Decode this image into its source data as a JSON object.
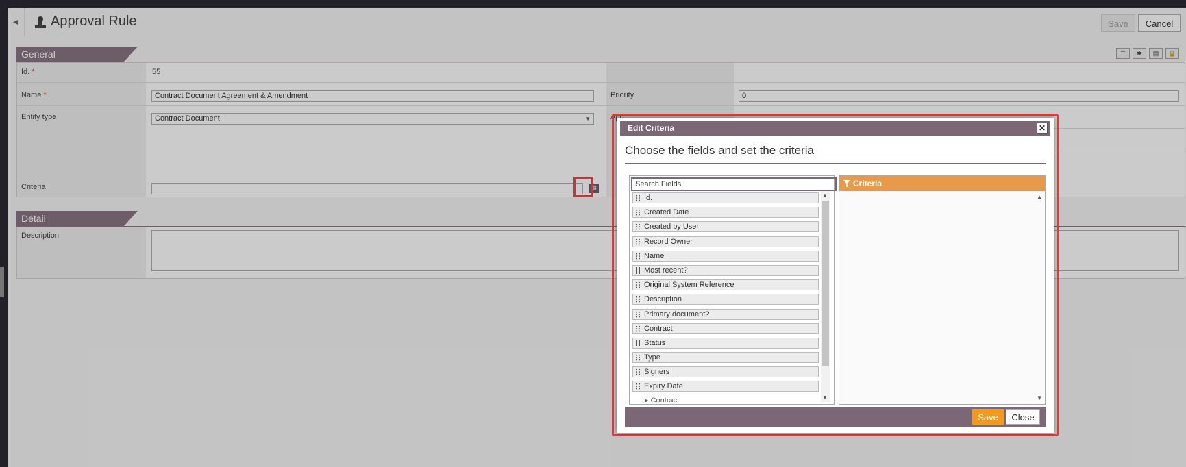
{
  "header": {
    "title": "Approval Rule",
    "save_label": "Save",
    "cancel_label": "Cancel"
  },
  "general": {
    "section_title": "General",
    "id_label": "Id.",
    "id_value": "55",
    "name_label": "Name",
    "name_value": "Contract Document Agreement & Amendment",
    "priority_label": "Priority",
    "priority_value": "0",
    "entity_type_label": "Entity type",
    "entity_type_value": "Contract Document",
    "approval_label": "App",
    "criteria_label": "Criteria",
    "required_mark": "*"
  },
  "detail": {
    "section_title": "Detail",
    "description_label": "Description"
  },
  "dialog": {
    "title": "Edit Criteria",
    "heading": "Choose the fields and set the criteria",
    "search_placeholder": "Search Fields",
    "criteria_title": "Criteria",
    "fields": [
      {
        "label": "Id.",
        "grip": "dots"
      },
      {
        "label": "Created Date",
        "grip": "dots"
      },
      {
        "label": "Created by User",
        "grip": "dots"
      },
      {
        "label": "Record Owner",
        "grip": "dots"
      },
      {
        "label": "Name",
        "grip": "dots"
      },
      {
        "label": "Most recent?",
        "grip": "bars"
      },
      {
        "label": "Original System Reference",
        "grip": "dots"
      },
      {
        "label": "Description",
        "grip": "dots"
      },
      {
        "label": "Primary document?",
        "grip": "dots"
      },
      {
        "label": "Contract",
        "grip": "dots"
      },
      {
        "label": "Status",
        "grip": "bars"
      },
      {
        "label": "Type",
        "grip": "dots"
      },
      {
        "label": "Signers",
        "grip": "dots"
      },
      {
        "label": "Expiry Date",
        "grip": "dots"
      }
    ],
    "sub_group": "Contract",
    "save_label": "Save",
    "close_label": "Close"
  }
}
